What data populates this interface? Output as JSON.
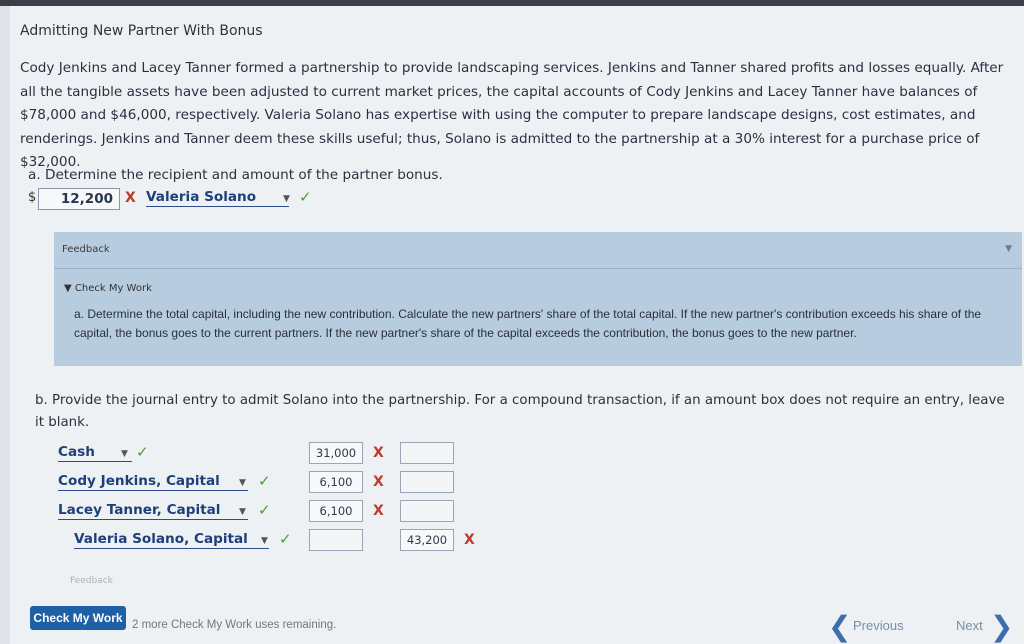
{
  "title": "Admitting New Partner With Bonus",
  "problem_text": "Cody Jenkins and Lacey Tanner formed a partnership to provide landscaping services. Jenkins and Tanner shared profits and losses equally. After all the tangible assets have been adjusted to current market prices, the capital accounts of Cody Jenkins and Lacey Tanner have balances of $78,000 and $46,000, respectively. Valeria Solano has expertise with using the computer to prepare landscape designs, cost estimates, and renderings. Jenkins and Tanner deem these skills useful; thus, Solano is admitted to the partnership at a 30% interest for a purchase price of $32,000.",
  "part_a": {
    "question": "a. Determine the recipient and amount of the partner bonus.",
    "currency": "$",
    "amount": "12,200",
    "amount_mark": "X",
    "recipient": "Valeria Solano",
    "recipient_mark": "✓"
  },
  "feedback": {
    "label": "Feedback",
    "check_my_work_label": "Check My Work",
    "text": "a. Determine the total capital, including the new contribution. Calculate the new partners' share of the total capital. If the new partner's contribution exceeds his share of the capital, the bonus goes to the current partners. If the new partner's share of the capital exceeds the contribution, the bonus goes to the new partner."
  },
  "part_b": {
    "question": "b. Provide the journal entry to admit Solano into the partnership. For a compound transaction, if an amount box does not require an entry, leave it blank.",
    "rows": [
      {
        "account": "Cash",
        "account_mark": "✓",
        "debit": "31,000",
        "debit_mark": "X",
        "credit": ""
      },
      {
        "account": "Cody Jenkins, Capital",
        "account_mark": "✓",
        "debit": "6,100",
        "debit_mark": "X",
        "credit": ""
      },
      {
        "account": "Lacey Tanner, Capital",
        "account_mark": "✓",
        "debit": "6,100",
        "debit_mark": "X",
        "credit": ""
      },
      {
        "account": "Valeria Solano, Capital",
        "account_mark": "✓",
        "debit": "",
        "credit": "43,200",
        "credit_mark": "X"
      }
    ]
  },
  "faded_feedback_label": "Feedback",
  "footer": {
    "check_button": "Check My Work",
    "remaining": "2 more Check My Work uses remaining.",
    "previous": "Previous",
    "next": "Next"
  },
  "colors": {
    "correct": "#4f9a32",
    "incorrect": "#c0392b",
    "accent": "#1f5fa6",
    "feedback_bg": "#b8cce0"
  }
}
